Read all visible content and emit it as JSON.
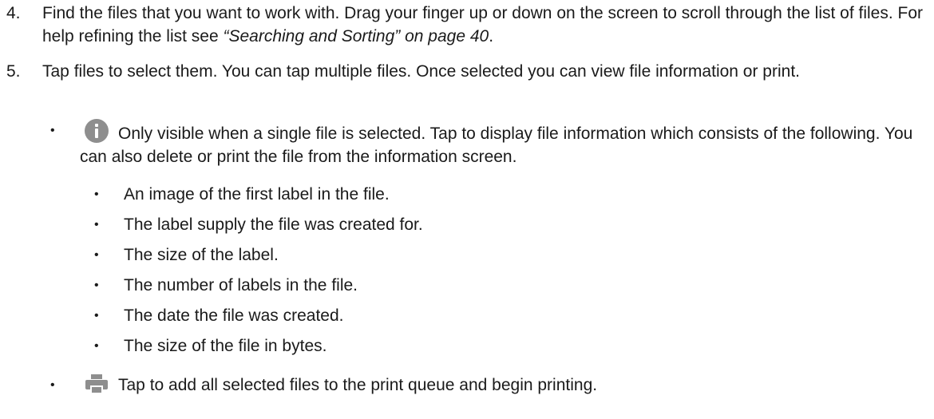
{
  "steps": [
    {
      "number": "4.",
      "text": "Find the files that you want to work with. Drag your finger up or down on the screen to scroll through the list of files. For help refining the list see ",
      "xref": "“Searching and Sorting” on page 40",
      "tail": "."
    },
    {
      "number": "5.",
      "text": "Tap files to select them. You can tap multiple files. Once selected you can view file information or print."
    }
  ],
  "bullets": {
    "dot": "•",
    "info": {
      "icon": "info-icon",
      "text": "Only visible when a single file is selected. Tap to display file information which consists of the following. You can also delete or print the file from the information screen."
    },
    "info_items": [
      "An image of the first label in the file.",
      "The label supply the file was created for.",
      "The size of the label.",
      "The number of labels in the file.",
      "The date the file was created.",
      "The size of the file in bytes."
    ],
    "print": {
      "icon": "print-icon",
      "text": "Tap to add all selected files to the print queue and begin printing."
    }
  },
  "colors": {
    "icon_gray": "#8e8e8e",
    "text": "#1a1a1a"
  }
}
